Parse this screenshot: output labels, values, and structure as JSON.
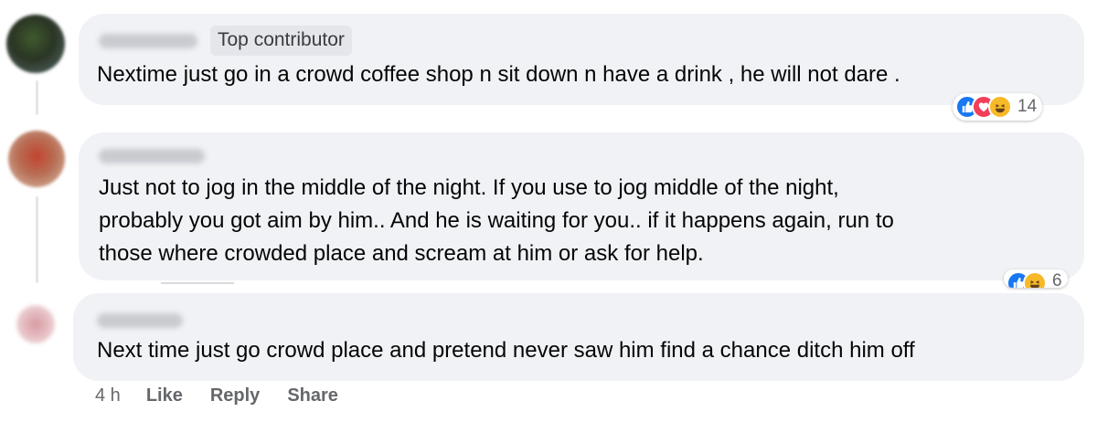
{
  "comments": [
    {
      "badge": "Top contributor",
      "text": "Nextime just go in a crowd coffee shop n sit down n have a drink , he will not dare .",
      "reactions": {
        "types": [
          "like",
          "love",
          "haha"
        ],
        "count": "14"
      }
    },
    {
      "text_lines": [
        "Just not to jog in the middle of the night. If you use to jog middle of the night,",
        "probably you got aim by him.. And he is waiting for you.. if it happens again, run to",
        "those where crowded place and scream at him or ask for help."
      ],
      "reactions": {
        "types": [
          "like",
          "haha"
        ],
        "count": "6"
      }
    },
    {
      "text": "Next time just go crowd place and pretend never saw him find a chance ditch him off",
      "actions": {
        "time": "4 h",
        "like": "Like",
        "reply": "Reply",
        "share": "Share"
      }
    }
  ],
  "colors": {
    "bubble": "#f0f2f5",
    "secondary_text": "#65676b",
    "like": "#1877f2",
    "love": "#f33e58",
    "haha": "#f7b928"
  }
}
